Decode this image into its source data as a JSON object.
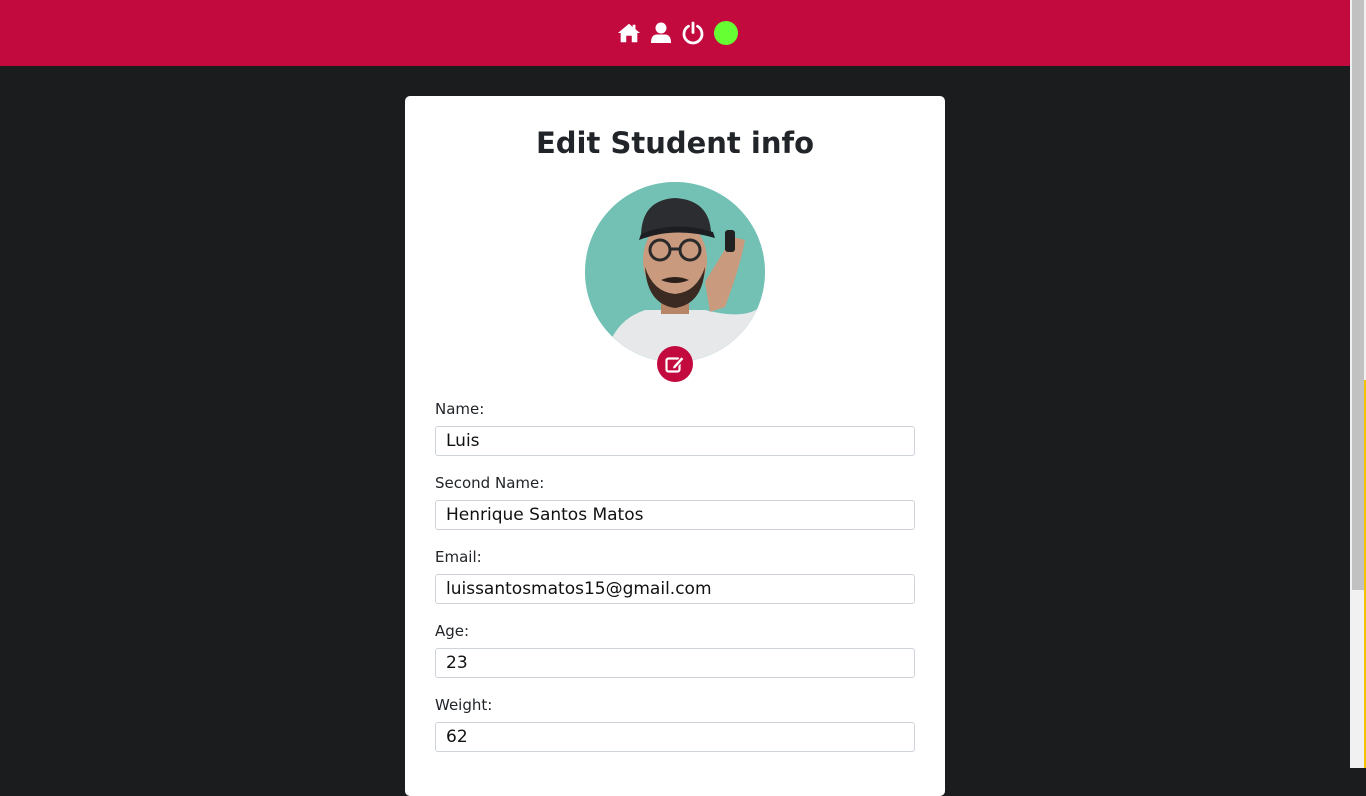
{
  "nav": {
    "icons": [
      "home-icon",
      "user-icon",
      "power-icon"
    ],
    "status_color": "#66ff33"
  },
  "colors": {
    "accent": "#c20a3e",
    "background": "#1b1c1e",
    "avatar_bg": "#72c1b4"
  },
  "form": {
    "title": "Edit Student info",
    "fields": [
      {
        "label": "Name:",
        "value": "Luis"
      },
      {
        "label": "Second Name:",
        "value": "Henrique Santos Matos"
      },
      {
        "label": "Email:",
        "value": "luissantosmatos15@gmail.com"
      },
      {
        "label": "Age:",
        "value": "23"
      },
      {
        "label": "Weight:",
        "value": "62"
      }
    ]
  }
}
